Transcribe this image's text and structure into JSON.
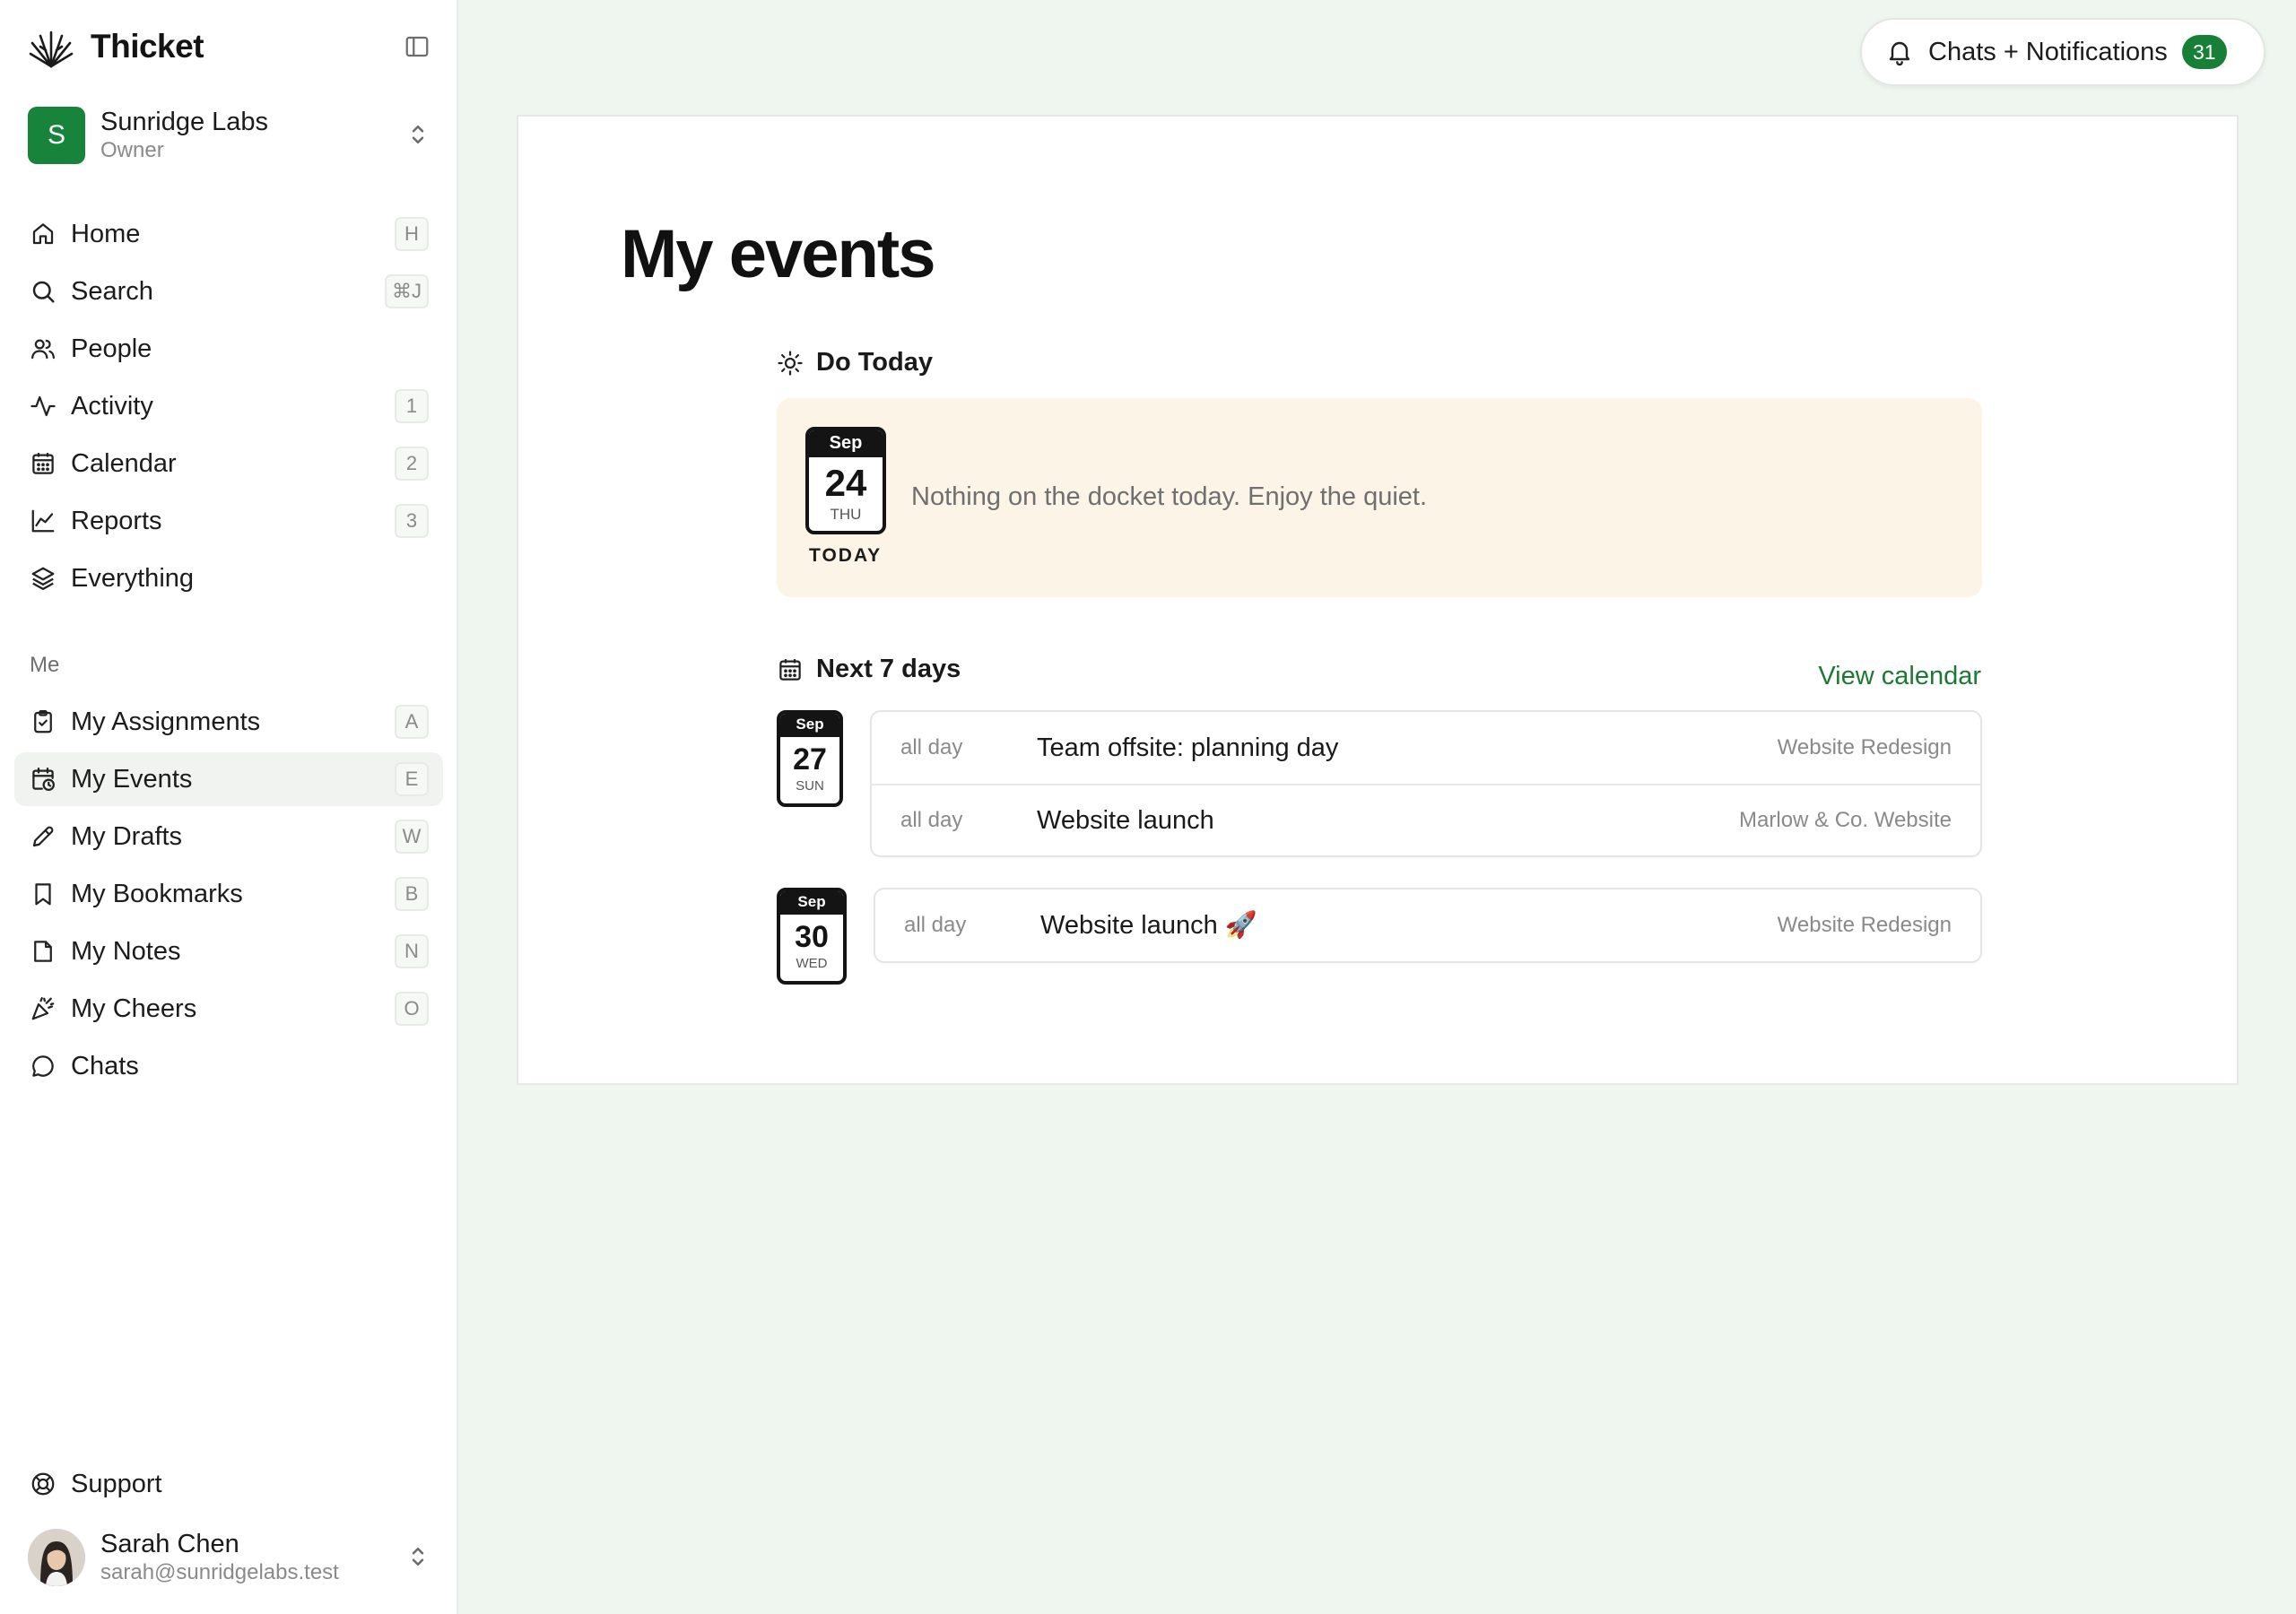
{
  "app": {
    "name": "Thicket",
    "workspace": {
      "initial": "S",
      "name": "Sunridge Labs",
      "role": "Owner"
    },
    "user": {
      "name": "Sarah Chen",
      "email": "sarah@sunridgelabs.test"
    }
  },
  "colors": {
    "accent": "#178036",
    "today_bg": "#fbf4e7",
    "page_bg": "#eff6ef"
  },
  "nav_main": [
    {
      "label": "Home",
      "shortcut": "H",
      "icon": "home-icon"
    },
    {
      "label": "Search",
      "shortcut": "⌘J",
      "icon": "search-icon"
    },
    {
      "label": "People",
      "shortcut": "",
      "icon": "people-icon"
    },
    {
      "label": "Activity",
      "shortcut": "1",
      "icon": "activity-icon"
    },
    {
      "label": "Calendar",
      "shortcut": "2",
      "icon": "calendar-icon"
    },
    {
      "label": "Reports",
      "shortcut": "3",
      "icon": "chart-icon"
    },
    {
      "label": "Everything",
      "shortcut": "",
      "icon": "layers-icon"
    }
  ],
  "nav_me_label": "Me",
  "nav_me": [
    {
      "label": "My Assignments",
      "shortcut": "A",
      "icon": "clipboard-check-icon"
    },
    {
      "label": "My Events",
      "shortcut": "E",
      "icon": "calendar-clock-icon",
      "active": true
    },
    {
      "label": "My Drafts",
      "shortcut": "W",
      "icon": "pencil-icon"
    },
    {
      "label": "My Bookmarks",
      "shortcut": "B",
      "icon": "bookmark-icon"
    },
    {
      "label": "My Notes",
      "shortcut": "N",
      "icon": "note-icon"
    },
    {
      "label": "My Cheers",
      "shortcut": "O",
      "icon": "party-popper-icon"
    },
    {
      "label": "Chats",
      "shortcut": "",
      "icon": "chat-bubble-icon"
    }
  ],
  "support_label": "Support",
  "notifications": {
    "label": "Chats + Notifications",
    "count": "31"
  },
  "page": {
    "title": "My events",
    "do_today": {
      "heading": "Do Today",
      "month": "Sep",
      "day": "24",
      "weekday": "THU",
      "today_label": "TODAY",
      "empty_message": "Nothing on the docket today. Enjoy the quiet."
    },
    "next_days": {
      "heading": "Next 7 days",
      "view_calendar": "View calendar",
      "groups": [
        {
          "month": "Sep",
          "day": "27",
          "weekday": "SUN",
          "events": [
            {
              "time": "all day",
              "title": "Team offsite: planning day",
              "project": "Website Redesign"
            },
            {
              "time": "all day",
              "title": "Website launch",
              "project": "Marlow & Co. Website"
            }
          ]
        },
        {
          "month": "Sep",
          "day": "30",
          "weekday": "WED",
          "events": [
            {
              "time": "all day",
              "title": "Website launch 🚀",
              "project": "Website Redesign"
            }
          ]
        }
      ]
    }
  }
}
